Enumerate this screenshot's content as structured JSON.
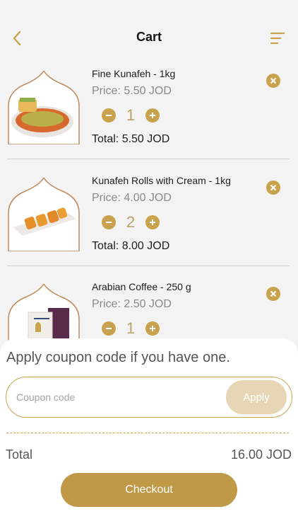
{
  "header": {
    "title": "Cart",
    "back_icon": "chevron-left-icon",
    "menu_icon": "filter-lines-icon"
  },
  "items": [
    {
      "name": "Fine Kunafeh - 1kg",
      "price": "Price: 5.50 JOD",
      "quantity": "1",
      "total": "Total: 5.50 JOD"
    },
    {
      "name": "Kunafeh Rolls with Cream - 1kg",
      "price": "Price: 4.00 JOD",
      "quantity": "2",
      "total": "Total: 8.00 JOD"
    },
    {
      "name": "Arabian Coffee - 250 g",
      "price": "Price: 2.50 JOD",
      "quantity": "1",
      "total": ""
    }
  ],
  "coupon": {
    "heading": "Apply coupon code if you have one.",
    "placeholder": "Coupon code",
    "value": "",
    "apply_label": "Apply"
  },
  "summary": {
    "total_label": "Total",
    "total_value": "16.00 JOD"
  },
  "checkout_label": "Checkout",
  "colors": {
    "accent": "#c9a24d",
    "checkout": "#bf9946",
    "apply_disabled": "#e6d6b6"
  }
}
